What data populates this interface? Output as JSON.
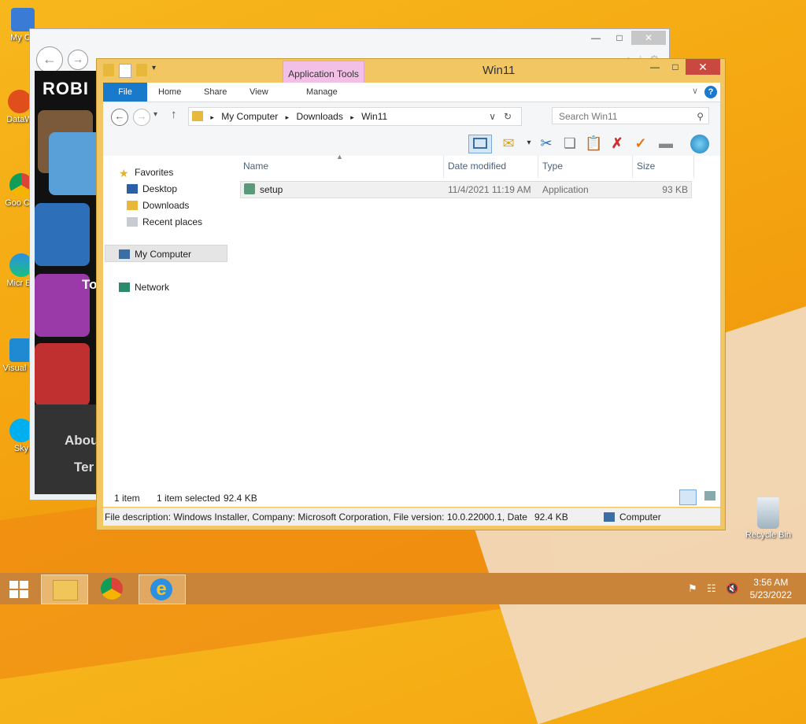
{
  "desktop": {
    "icons": [
      {
        "label": "My Co",
        "icon": "computer-icon"
      },
      {
        "label": "DataW",
        "icon": "datawrapper-icon"
      },
      {
        "label": "Goo Chr",
        "icon": "chrome-icon"
      },
      {
        "label": "Micr Ed",
        "icon": "edge-icon"
      },
      {
        "label": "Visual Co",
        "icon": "vscode-icon"
      },
      {
        "label": "Sky",
        "icon": "skype-icon"
      }
    ],
    "recycle_bin": "Recycle Bin"
  },
  "browser": {
    "roblox_logo": "ROBI",
    "to_text": "To",
    "about": "Abou",
    "terms": "Ter"
  },
  "explorer": {
    "title": "Win11",
    "contextual_tab_group": "Application Tools",
    "tabs": [
      "File",
      "Home",
      "Share",
      "View",
      "Manage"
    ],
    "breadcrumb": [
      "My Computer",
      "Downloads",
      "Win11"
    ],
    "search_placeholder": "Search Win11",
    "nav": {
      "favorites": "Favorites",
      "favorites_items": [
        "Desktop",
        "Downloads",
        "Recent places"
      ],
      "my_computer": "My Computer",
      "network": "Network"
    },
    "columns": {
      "name": "Name",
      "date": "Date modified",
      "type": "Type",
      "size": "Size"
    },
    "files": [
      {
        "name": "setup",
        "date": "11/4/2021 11:19 AM",
        "type": "Application",
        "size": "93 KB"
      }
    ],
    "status": {
      "count": "1 item",
      "selected": "1 item selected",
      "selected_size": "92.4 KB"
    },
    "details": {
      "description": "File description: Windows Installer, Company: Microsoft Corporation, File version: 10.0.22000.1, Date cre",
      "size": "92.4 KB",
      "location": "Computer"
    }
  },
  "taskbar": {
    "time": "3:56 AM",
    "date": "5/23/2022"
  }
}
